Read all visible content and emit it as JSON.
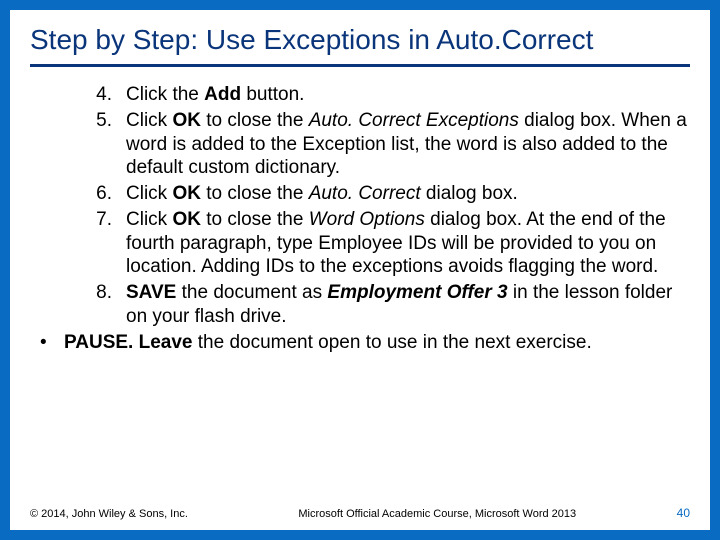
{
  "title": "Step by Step: Use Exceptions in Auto.Correct",
  "steps": [
    {
      "num": "4.",
      "runs": [
        {
          "t": "Click the "
        },
        {
          "t": "Add",
          "cls": "b"
        },
        {
          "t": " button."
        }
      ]
    },
    {
      "num": "5.",
      "runs": [
        {
          "t": "Click "
        },
        {
          "t": "OK",
          "cls": "b"
        },
        {
          "t": " to close the "
        },
        {
          "t": "Auto. Correct Exceptions",
          "cls": "i"
        },
        {
          "t": " dialog box. When a word is added to the Exception list, the word is also added to the default custom dictionary."
        }
      ]
    },
    {
      "num": "6.",
      "runs": [
        {
          "t": "Click "
        },
        {
          "t": "OK",
          "cls": "b"
        },
        {
          "t": " to close the "
        },
        {
          "t": "Auto. Correct",
          "cls": "i"
        },
        {
          "t": " dialog box."
        }
      ]
    },
    {
      "num": "7.",
      "runs": [
        {
          "t": "Click "
        },
        {
          "t": "OK",
          "cls": "b"
        },
        {
          "t": " to close the "
        },
        {
          "t": "Word Options",
          "cls": "i"
        },
        {
          "t": " dialog box. At the end of the fourth paragraph, type Employee IDs will be provided to you on location. Adding IDs to the exceptions avoids flagging the word."
        }
      ]
    },
    {
      "num": "8.",
      "runs": [
        {
          "t": " "
        },
        {
          "t": "SAVE",
          "cls": "b"
        },
        {
          "t": " the document as "
        },
        {
          "t": "Employment Offer 3",
          "cls": "bi"
        },
        {
          "t": " in the lesson folder on your flash drive."
        }
      ]
    }
  ],
  "bullet": {
    "mark": "•",
    "runs": [
      {
        "t": "PAUSE. Leave",
        "cls": "b"
      },
      {
        "t": " the document open to use in the next exercise."
      }
    ]
  },
  "footer": {
    "left": "© 2014, John Wiley & Sons, Inc.",
    "center": "Microsoft Official Academic Course, Microsoft Word 2013",
    "right": "40"
  }
}
